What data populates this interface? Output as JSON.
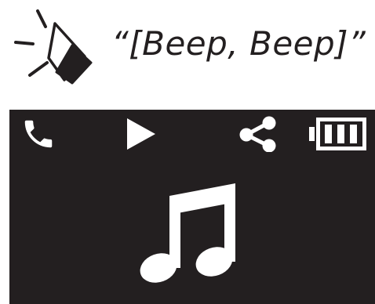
{
  "caption": {
    "text": "“[Beep, Beep]”",
    "icon": "speaker-icon"
  },
  "device": {
    "status_icons": [
      "phone-icon",
      "play-icon",
      "share-icon",
      "battery-icon"
    ],
    "battery_level": 1.0,
    "main_icon": "music-note-icon"
  },
  "colors": {
    "screen_bg": "#231f20",
    "icon": "#ffffff",
    "text": "#231f20"
  }
}
